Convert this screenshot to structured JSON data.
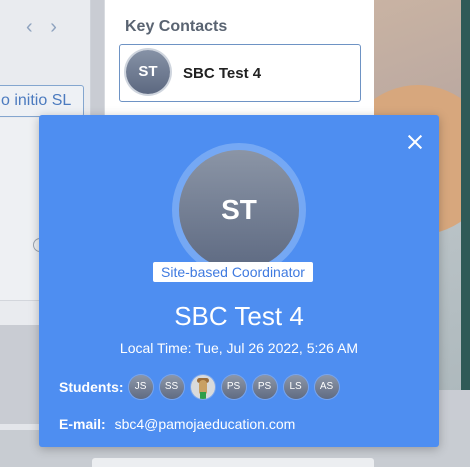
{
  "background": {
    "partial_field_text": "o initio SL"
  },
  "key_contacts": {
    "title": "Key Contacts",
    "card": {
      "initials": "ST",
      "name": "SBC Test 4"
    }
  },
  "popup": {
    "avatar_initials": "ST",
    "role": "Site-based Coordinator",
    "name": "SBC Test 4",
    "local_time": "Local Time: Tue, Jul 26 2022, 5:26 AM",
    "students_label": "Students:",
    "students": [
      {
        "initials": "JS",
        "icon": null
      },
      {
        "initials": "SS",
        "icon": null
      },
      {
        "initials": "",
        "icon": "giraffe-photo-icon"
      },
      {
        "initials": "PS",
        "icon": null
      },
      {
        "initials": "PS",
        "icon": null
      },
      {
        "initials": "LS",
        "icon": null
      },
      {
        "initials": "AS",
        "icon": null
      }
    ],
    "email_label": "E-mail:",
    "email": "sbc4@pamojaeducation.com"
  },
  "colors": {
    "popup_bg": "#4e8ef1",
    "role_text": "#3f7ae0",
    "card_border": "#6e93c4"
  }
}
